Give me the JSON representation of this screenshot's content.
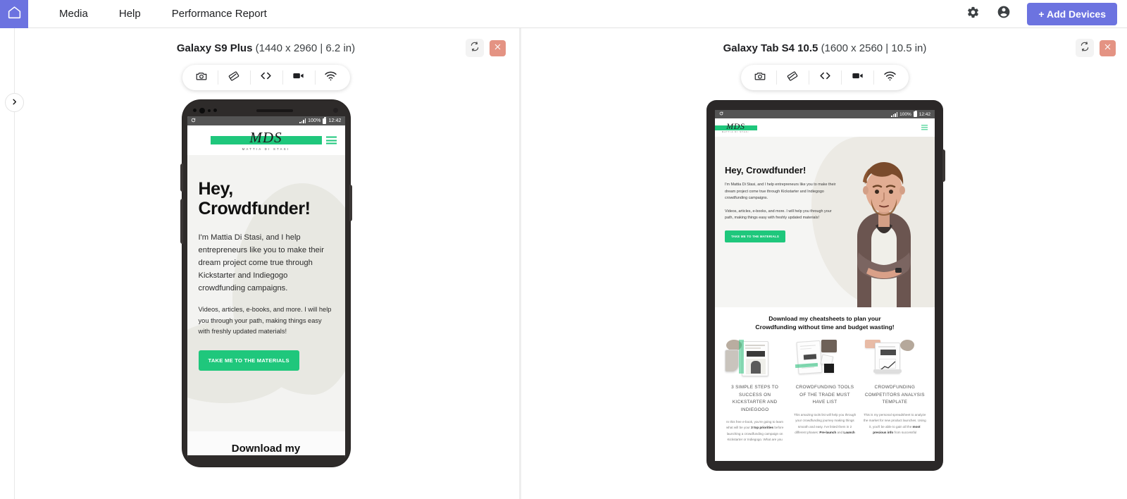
{
  "topbar": {
    "home_icon": "home-icon",
    "nav": [
      {
        "label": "Media"
      },
      {
        "label": "Help"
      },
      {
        "label": "Performance Report"
      }
    ],
    "settings_icon": "gear-icon",
    "account_icon": "account-circle-icon",
    "add_devices_label": "+ Add Devices"
  },
  "left_rail": {
    "expand_icon": "chevron-right-icon"
  },
  "toolbar_buttons": [
    {
      "name": "screenshot-button",
      "icon": "camera-icon"
    },
    {
      "name": "rotate-orientation-button",
      "icon": "screen-rotation-icon"
    },
    {
      "name": "inspect-code-button",
      "icon": "code-icon"
    },
    {
      "name": "record-video-button",
      "icon": "video-camera-icon"
    },
    {
      "name": "network-throttle-button",
      "icon": "wifi-icon"
    }
  ],
  "devices": [
    {
      "name": "Galaxy S9 Plus",
      "spec": "(1440 x 2960 | 6.2 in)",
      "rotate_icon": "rotate-icon",
      "close_icon": "close-icon",
      "status_bar": {
        "battery": "100%",
        "time": "12:42"
      }
    },
    {
      "name": "Galaxy Tab S4 10.5",
      "spec": "(1600 x 2560 | 10.5 in)",
      "rotate_icon": "rotate-icon",
      "close_icon": "close-icon",
      "status_bar": {
        "battery": "100%",
        "time": "12:42"
      }
    }
  ],
  "site": {
    "logo": "MDS",
    "logo_sub": "MATTIA DI STASI",
    "hero_heading": "Hey, Crowdfunder!",
    "hero_heading_line1": "Hey,",
    "hero_heading_line2": "Crowdfunder!",
    "hero_paragraph_1": "I'm Mattia Di Stasi, and I help entrepreneurs like you to make their dream project come true through Kickstarter and Indiegogo crowdfunding campaigns.",
    "hero_paragraph_2": "Videos, articles, e-books, and more. I will help you through your path, making things easy with freshly updated materials!",
    "cta_label": "TAKE ME TO THE MATERIALS",
    "section_heading_phone": "Download my",
    "section_heading_line1": "Download my cheatsheets to plan your",
    "section_heading_line2": "Crowdfunding without time and budget wasting!",
    "cards": [
      {
        "title": "3 SIMPLE STEPS TO SUCCESS ON KICKSTARTER AND INDIEGOGO",
        "body_a": "In this free e-book, you're going to learn what will be your ",
        "body_b": "3 top priorities",
        "body_c": " before launching a crowdfunding campaign on Kickstarter or Indiegogo. What are you"
      },
      {
        "title": "CROWDFUNDING TOOLS OF THE TRADE MUST HAVE LIST",
        "body_a": "This amazing tools list will help you through your crowdfunding journey making things smooth and easy. I've listed them in 2 different phases: ",
        "body_b": "Pre-launch",
        "body_c": " and ",
        "body_d": "Launch"
      },
      {
        "title": "CROWDFUNDING COMPETITORS ANALYSIS TEMPLATE",
        "body_a": "This is my personal spreadsheet to analyze the market for new product launches. Using it, you'll be able to gain all the ",
        "body_b": "most precious info",
        "body_c": " from successful"
      }
    ]
  },
  "colors": {
    "brand_purple": "#6c73e0",
    "cta_green": "#1fc77c",
    "close_salmon": "#e49383"
  }
}
